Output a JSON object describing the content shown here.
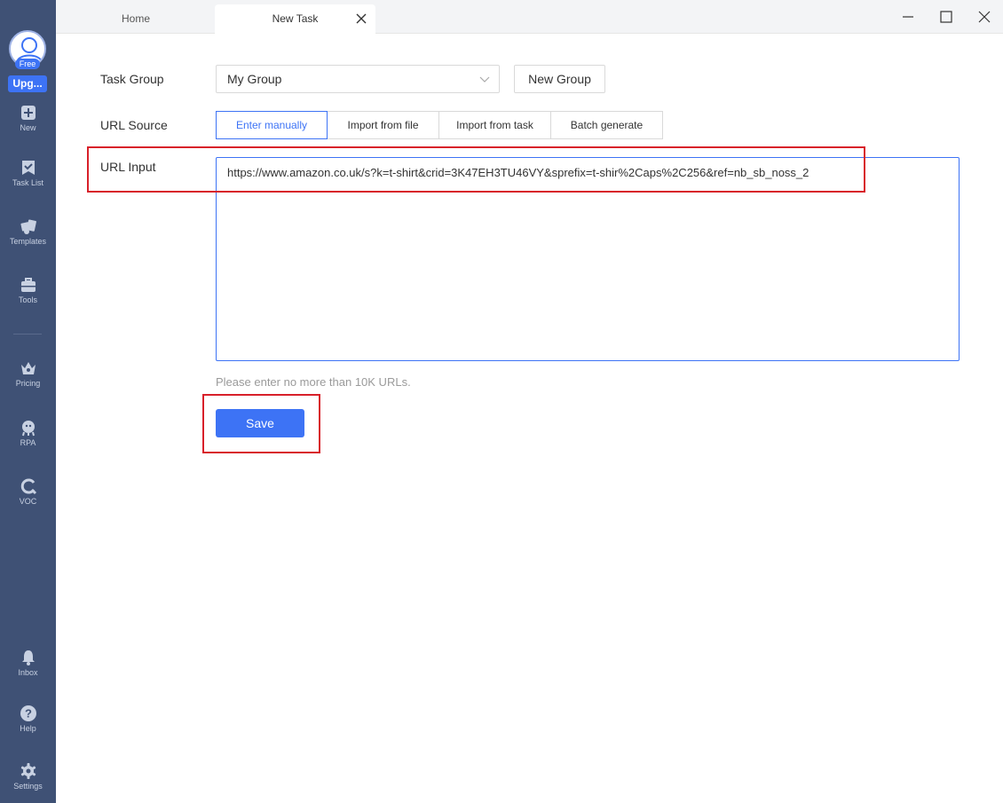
{
  "sidebar": {
    "badge": "Free",
    "upgrade_label": "Upg...",
    "items": [
      {
        "label": "New",
        "icon": "plus-square-icon"
      },
      {
        "label": "Task List",
        "icon": "checklist-icon"
      },
      {
        "label": "Templates",
        "icon": "templates-icon"
      },
      {
        "label": "Tools",
        "icon": "toolbox-icon"
      },
      {
        "label": "Pricing",
        "icon": "crown-icon"
      },
      {
        "label": "RPA",
        "icon": "rpa-robot-icon"
      },
      {
        "label": "VOC",
        "icon": "voc-icon"
      },
      {
        "label": "Inbox",
        "icon": "bell-icon"
      },
      {
        "label": "Help",
        "icon": "help-icon"
      },
      {
        "label": "Settings",
        "icon": "gear-icon"
      }
    ]
  },
  "tabs": {
    "home": "Home",
    "new_task": "New Task"
  },
  "form": {
    "task_group_label": "Task Group",
    "task_group_value": "My Group",
    "new_group_button": "New Group",
    "url_source_label": "URL Source",
    "url_source_options": [
      "Enter manually",
      "Import from file",
      "Import from task",
      "Batch generate"
    ],
    "url_input_label": "URL Input",
    "url_input_value": "https://www.amazon.co.uk/s?k=t-shirt&crid=3K47EH3TU46VY&sprefix=t-shir%2Caps%2C256&ref=nb_sb_noss_2",
    "hint": "Please enter no more than 10K URLs.",
    "save_button": "Save"
  },
  "colors": {
    "accent": "#3d73f5",
    "sidebar_bg": "#3f5175",
    "highlight": "#d8202a"
  }
}
